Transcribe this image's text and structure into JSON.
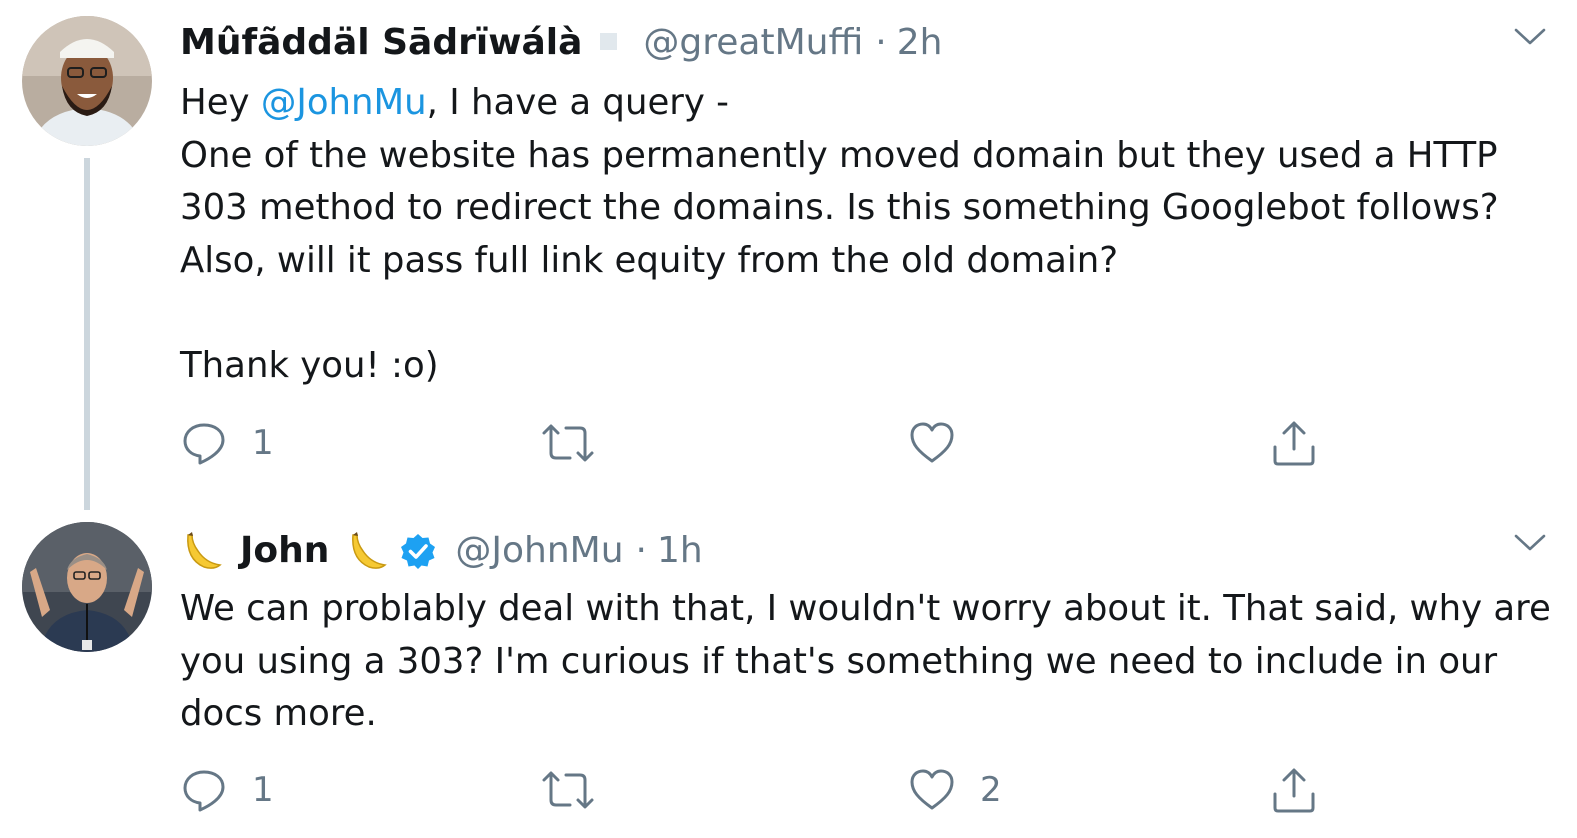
{
  "tweets": [
    {
      "author_name": "Mûfãddäl Sādrïwálà",
      "handle": "@greatMuffi",
      "time": "2h",
      "text_before_mention": "Hey ",
      "mention": "@JohnMu",
      "text_after_mention": ", I have a query -\nOne of the website has permanently moved domain but they used a HTTP 303 method to redirect the domains. Is this something Googlebot follows? Also, will it pass full link equity from the old domain?\n\nThank you! :o)",
      "reply_count": "1",
      "retweet_count": "",
      "like_count": ""
    },
    {
      "author_name": "John",
      "handle": "@JohnMu",
      "time": "1h",
      "text": "We can problably deal with that, I wouldn't worry about it. That said, why are you using a 303? I'm curious if that's something we need to include in our docs more.",
      "reply_count": "1",
      "retweet_count": "",
      "like_count": "2"
    }
  ],
  "separator_dot": "·",
  "colors": {
    "accent": "#1b95e0",
    "secondary_text": "#657786",
    "thread_line": "#ccd6dd"
  },
  "icons": [
    "reply-icon",
    "retweet-icon",
    "like-icon",
    "share-icon",
    "caret-down-icon",
    "verified-badge-icon",
    "banana-emoji-icon"
  ]
}
